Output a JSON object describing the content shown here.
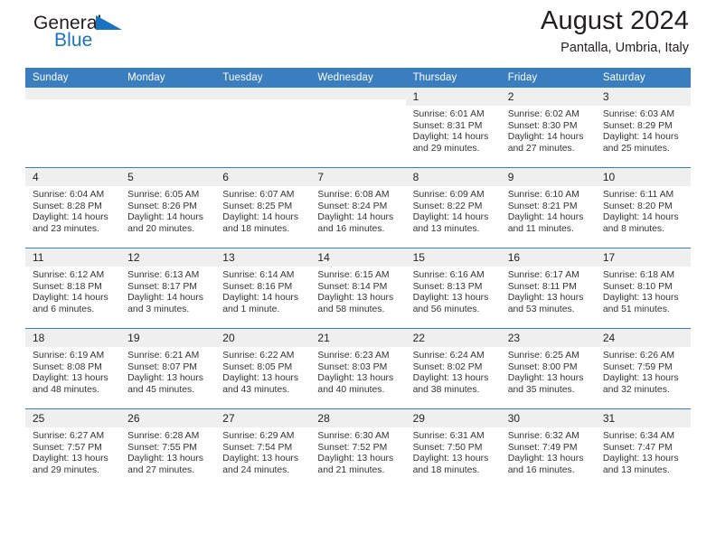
{
  "brand": {
    "name_part1": "General",
    "name_part2": "Blue",
    "flag_icon": "blue-triangle-flag-icon",
    "colors": {
      "text": "#231f20",
      "blue": "#1a73c0"
    }
  },
  "header": {
    "title": "August 2024",
    "subtitle": "Pantalla, Umbria, Italy"
  },
  "theme": {
    "header_blue": "#3a7ebf",
    "daynum_gray": "#efefef",
    "body_text": "#333333"
  },
  "calendar": {
    "weekday_headers": [
      "Sunday",
      "Monday",
      "Tuesday",
      "Wednesday",
      "Thursday",
      "Friday",
      "Saturday"
    ],
    "weeks": [
      [
        {
          "day": "",
          "empty": true
        },
        {
          "day": "",
          "empty": true
        },
        {
          "day": "",
          "empty": true
        },
        {
          "day": "",
          "empty": true
        },
        {
          "day": "1",
          "sunrise": "Sunrise: 6:01 AM",
          "sunset": "Sunset: 8:31 PM",
          "daylight": "Daylight: 14 hours and 29 minutes."
        },
        {
          "day": "2",
          "sunrise": "Sunrise: 6:02 AM",
          "sunset": "Sunset: 8:30 PM",
          "daylight": "Daylight: 14 hours and 27 minutes."
        },
        {
          "day": "3",
          "sunrise": "Sunrise: 6:03 AM",
          "sunset": "Sunset: 8:29 PM",
          "daylight": "Daylight: 14 hours and 25 minutes."
        }
      ],
      [
        {
          "day": "4",
          "sunrise": "Sunrise: 6:04 AM",
          "sunset": "Sunset: 8:28 PM",
          "daylight": "Daylight: 14 hours and 23 minutes."
        },
        {
          "day": "5",
          "sunrise": "Sunrise: 6:05 AM",
          "sunset": "Sunset: 8:26 PM",
          "daylight": "Daylight: 14 hours and 20 minutes."
        },
        {
          "day": "6",
          "sunrise": "Sunrise: 6:07 AM",
          "sunset": "Sunset: 8:25 PM",
          "daylight": "Daylight: 14 hours and 18 minutes."
        },
        {
          "day": "7",
          "sunrise": "Sunrise: 6:08 AM",
          "sunset": "Sunset: 8:24 PM",
          "daylight": "Daylight: 14 hours and 16 minutes."
        },
        {
          "day": "8",
          "sunrise": "Sunrise: 6:09 AM",
          "sunset": "Sunset: 8:22 PM",
          "daylight": "Daylight: 14 hours and 13 minutes."
        },
        {
          "day": "9",
          "sunrise": "Sunrise: 6:10 AM",
          "sunset": "Sunset: 8:21 PM",
          "daylight": "Daylight: 14 hours and 11 minutes."
        },
        {
          "day": "10",
          "sunrise": "Sunrise: 6:11 AM",
          "sunset": "Sunset: 8:20 PM",
          "daylight": "Daylight: 14 hours and 8 minutes."
        }
      ],
      [
        {
          "day": "11",
          "sunrise": "Sunrise: 6:12 AM",
          "sunset": "Sunset: 8:18 PM",
          "daylight": "Daylight: 14 hours and 6 minutes."
        },
        {
          "day": "12",
          "sunrise": "Sunrise: 6:13 AM",
          "sunset": "Sunset: 8:17 PM",
          "daylight": "Daylight: 14 hours and 3 minutes."
        },
        {
          "day": "13",
          "sunrise": "Sunrise: 6:14 AM",
          "sunset": "Sunset: 8:16 PM",
          "daylight": "Daylight: 14 hours and 1 minute."
        },
        {
          "day": "14",
          "sunrise": "Sunrise: 6:15 AM",
          "sunset": "Sunset: 8:14 PM",
          "daylight": "Daylight: 13 hours and 58 minutes."
        },
        {
          "day": "15",
          "sunrise": "Sunrise: 6:16 AM",
          "sunset": "Sunset: 8:13 PM",
          "daylight": "Daylight: 13 hours and 56 minutes."
        },
        {
          "day": "16",
          "sunrise": "Sunrise: 6:17 AM",
          "sunset": "Sunset: 8:11 PM",
          "daylight": "Daylight: 13 hours and 53 minutes."
        },
        {
          "day": "17",
          "sunrise": "Sunrise: 6:18 AM",
          "sunset": "Sunset: 8:10 PM",
          "daylight": "Daylight: 13 hours and 51 minutes."
        }
      ],
      [
        {
          "day": "18",
          "sunrise": "Sunrise: 6:19 AM",
          "sunset": "Sunset: 8:08 PM",
          "daylight": "Daylight: 13 hours and 48 minutes."
        },
        {
          "day": "19",
          "sunrise": "Sunrise: 6:21 AM",
          "sunset": "Sunset: 8:07 PM",
          "daylight": "Daylight: 13 hours and 45 minutes."
        },
        {
          "day": "20",
          "sunrise": "Sunrise: 6:22 AM",
          "sunset": "Sunset: 8:05 PM",
          "daylight": "Daylight: 13 hours and 43 minutes."
        },
        {
          "day": "21",
          "sunrise": "Sunrise: 6:23 AM",
          "sunset": "Sunset: 8:03 PM",
          "daylight": "Daylight: 13 hours and 40 minutes."
        },
        {
          "day": "22",
          "sunrise": "Sunrise: 6:24 AM",
          "sunset": "Sunset: 8:02 PM",
          "daylight": "Daylight: 13 hours and 38 minutes."
        },
        {
          "day": "23",
          "sunrise": "Sunrise: 6:25 AM",
          "sunset": "Sunset: 8:00 PM",
          "daylight": "Daylight: 13 hours and 35 minutes."
        },
        {
          "day": "24",
          "sunrise": "Sunrise: 6:26 AM",
          "sunset": "Sunset: 7:59 PM",
          "daylight": "Daylight: 13 hours and 32 minutes."
        }
      ],
      [
        {
          "day": "25",
          "sunrise": "Sunrise: 6:27 AM",
          "sunset": "Sunset: 7:57 PM",
          "daylight": "Daylight: 13 hours and 29 minutes."
        },
        {
          "day": "26",
          "sunrise": "Sunrise: 6:28 AM",
          "sunset": "Sunset: 7:55 PM",
          "daylight": "Daylight: 13 hours and 27 minutes."
        },
        {
          "day": "27",
          "sunrise": "Sunrise: 6:29 AM",
          "sunset": "Sunset: 7:54 PM",
          "daylight": "Daylight: 13 hours and 24 minutes."
        },
        {
          "day": "28",
          "sunrise": "Sunrise: 6:30 AM",
          "sunset": "Sunset: 7:52 PM",
          "daylight": "Daylight: 13 hours and 21 minutes."
        },
        {
          "day": "29",
          "sunrise": "Sunrise: 6:31 AM",
          "sunset": "Sunset: 7:50 PM",
          "daylight": "Daylight: 13 hours and 18 minutes."
        },
        {
          "day": "30",
          "sunrise": "Sunrise: 6:32 AM",
          "sunset": "Sunset: 7:49 PM",
          "daylight": "Daylight: 13 hours and 16 minutes."
        },
        {
          "day": "31",
          "sunrise": "Sunrise: 6:34 AM",
          "sunset": "Sunset: 7:47 PM",
          "daylight": "Daylight: 13 hours and 13 minutes."
        }
      ]
    ]
  }
}
